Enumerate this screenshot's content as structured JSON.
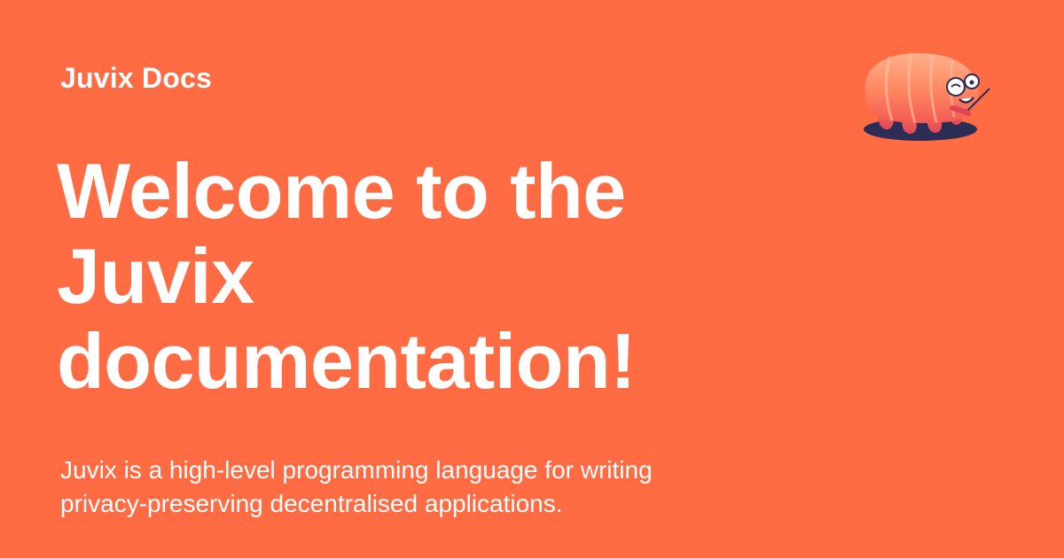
{
  "header": {
    "site_name": "Juvix Docs"
  },
  "main": {
    "title": "Welcome to the Juvix documentation!",
    "description": "Juvix is a high-level programming language for writing privacy-preserving decentralised applications."
  },
  "mascot": {
    "icon": "tardigrade-mascot-icon"
  },
  "colors": {
    "background": "#ff6b43",
    "text": "#ffffff",
    "mascot_body": "#ff8a5c",
    "mascot_shadow": "#2b2d55"
  }
}
